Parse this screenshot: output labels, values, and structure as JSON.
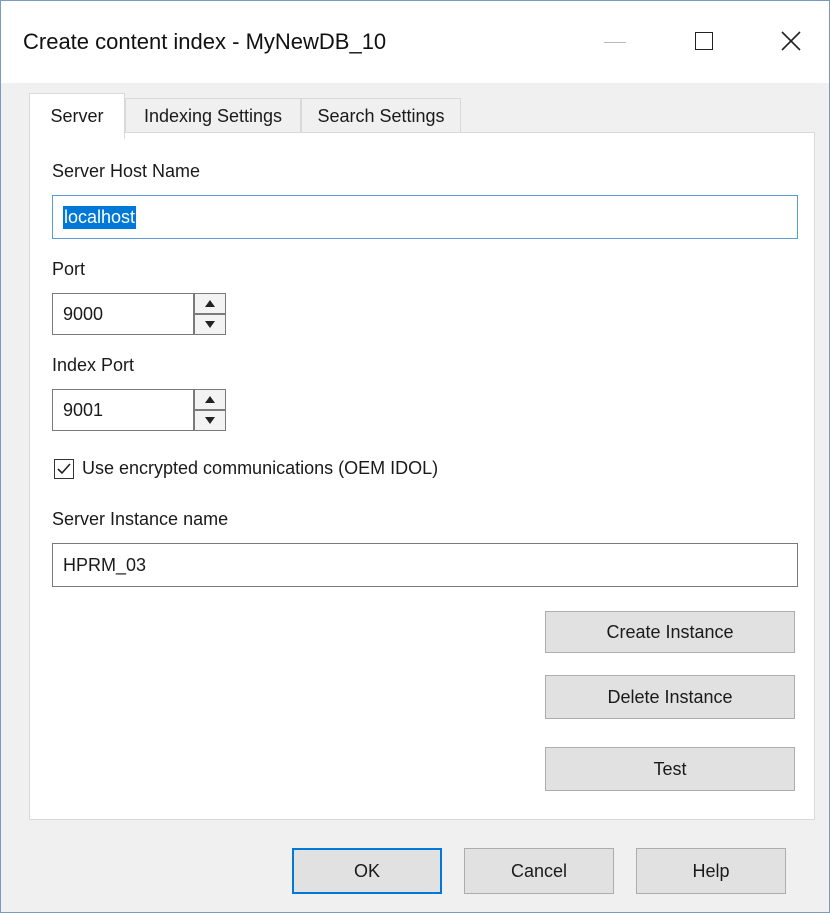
{
  "window": {
    "title": "Create content index - MyNewDB_10"
  },
  "tabs": [
    {
      "label": "Server",
      "active": true
    },
    {
      "label": "Indexing Settings",
      "active": false
    },
    {
      "label": "Search Settings",
      "active": false
    }
  ],
  "server": {
    "host_label": "Server Host Name",
    "host_value": "localhost",
    "port_label": "Port",
    "port_value": "9000",
    "index_port_label": "Index Port",
    "index_port_value": "9001",
    "encrypted_label": "Use encrypted communications (OEM IDOL)",
    "encrypted_checked": true,
    "instance_label": "Server Instance name",
    "instance_value": "HPRM_03",
    "create_instance": "Create Instance",
    "delete_instance": "Delete Instance",
    "test": "Test"
  },
  "footer": {
    "ok": "OK",
    "cancel": "Cancel",
    "help": "Help"
  },
  "colors": {
    "accent": "#0078d7",
    "selection": "#0078d7",
    "focus_border": "#5a9ad6"
  }
}
